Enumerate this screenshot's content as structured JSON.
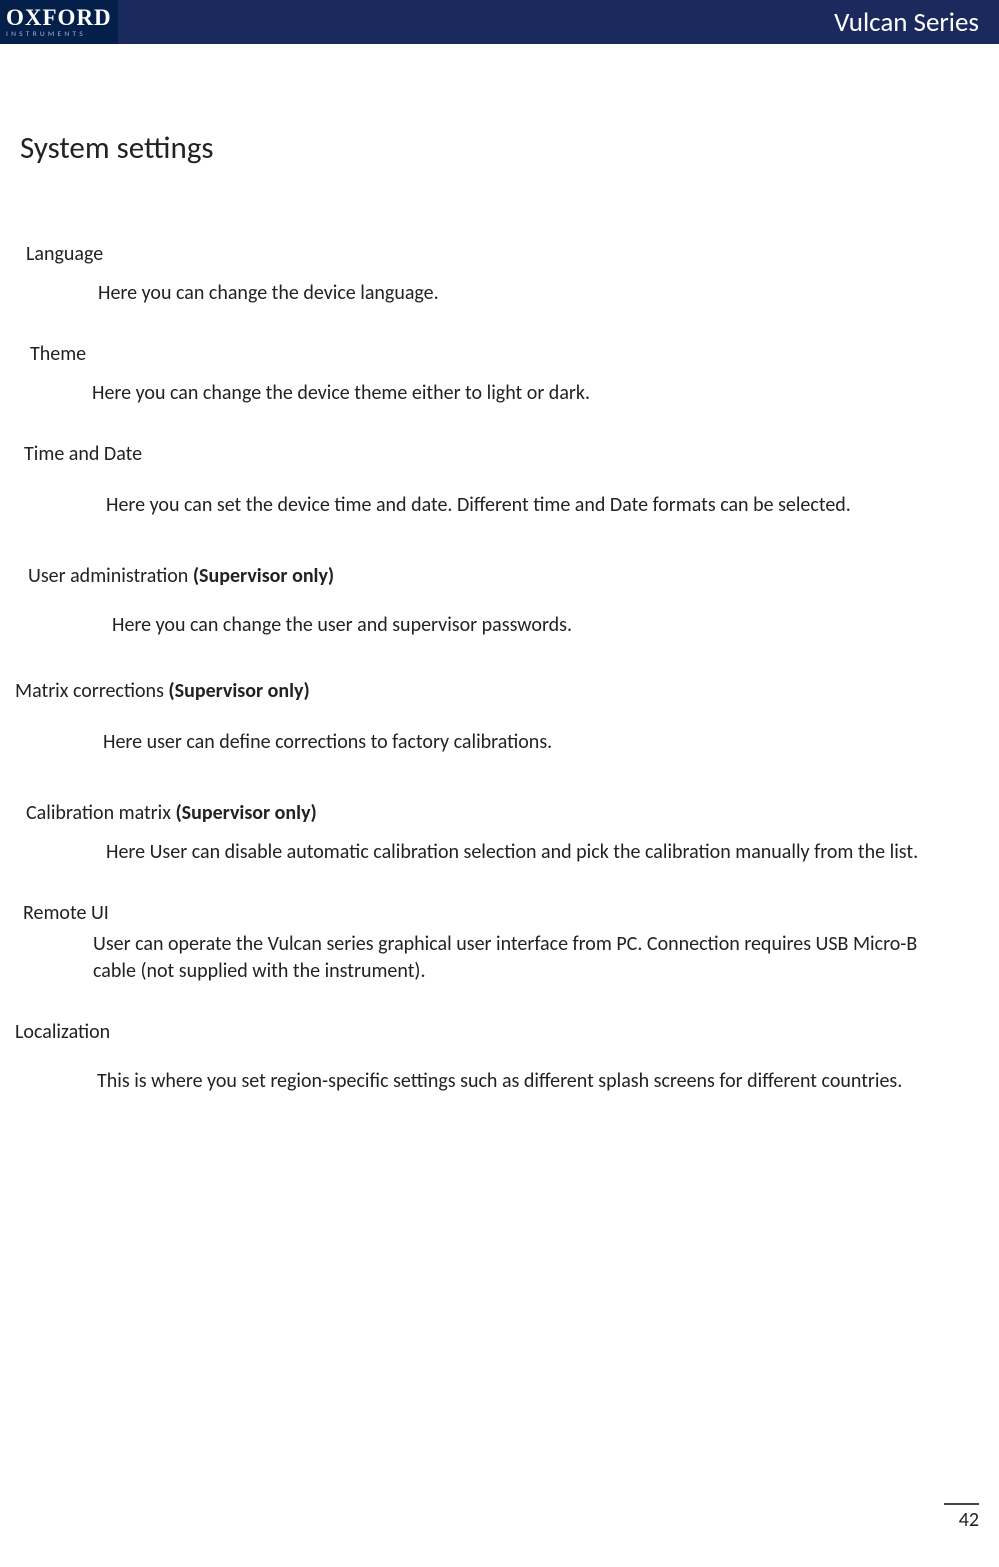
{
  "header": {
    "logo_main": "OXFORD",
    "logo_sub": "INSTRUMENTS",
    "title": "Vulcan Series"
  },
  "page_title": "System settings",
  "sections": {
    "language": {
      "heading": "Language",
      "body": "Here you can change the device language."
    },
    "theme": {
      "heading": "Theme",
      "body": "Here you can change the device theme either to light or dark."
    },
    "timedate": {
      "heading": "Time and Date",
      "body": "Here you can set the device time and date. Different time and Date formats can be selected."
    },
    "useradmin": {
      "heading_prefix": "User administration ",
      "heading_bold": "(Supervisor only)",
      "body": "Here you can change the user and supervisor passwords."
    },
    "matrix": {
      "heading_prefix": "Matrix corrections ",
      "heading_bold": "(Supervisor only)",
      "body": "Here user can define corrections to factory calibrations."
    },
    "calibration": {
      "heading_prefix": "Calibration matrix ",
      "heading_bold": "(Supervisor only)",
      "body": "Here User can disable automatic calibration selection and pick the calibration manually from the list."
    },
    "remote": {
      "heading": "Remote UI",
      "body": "User can operate the Vulcan series graphical user interface from PC. Connection requires USB Micro-B cable (not supplied with the instrument)."
    },
    "localization": {
      "heading": "Localization",
      "body": "This is where you set region-specific settings such as different splash screens for different countries."
    }
  },
  "page_number": "42"
}
